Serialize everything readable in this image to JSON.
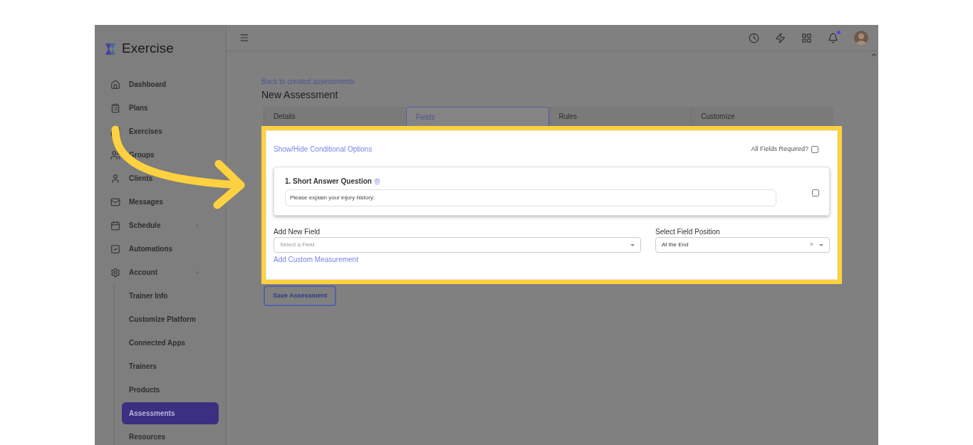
{
  "brand": "Exercise",
  "sidebar": {
    "items": [
      {
        "label": "Dashboard",
        "kind": "link",
        "selected": false
      },
      {
        "label": "Plans",
        "kind": "link",
        "selected": false
      },
      {
        "label": "Exercises",
        "kind": "link",
        "selected": false
      },
      {
        "label": "Groups",
        "kind": "link",
        "selected": false
      },
      {
        "label": "Clients",
        "kind": "link",
        "selected": false
      },
      {
        "label": "Messages",
        "kind": "link",
        "selected": false
      },
      {
        "label": "Schedule",
        "kind": "group",
        "expanded": false,
        "selected": false
      },
      {
        "label": "Automations",
        "kind": "link",
        "selected": false
      },
      {
        "label": "Account",
        "kind": "group",
        "expanded": true,
        "selected": false,
        "children": [
          {
            "label": "Trainer Info",
            "selected": false
          },
          {
            "label": "Customize Platform",
            "selected": false
          },
          {
            "label": "Connected Apps",
            "selected": false
          },
          {
            "label": "Trainers",
            "selected": false
          },
          {
            "label": "Products",
            "selected": false
          },
          {
            "label": "Assessments",
            "selected": true
          },
          {
            "label": "Resources",
            "selected": false
          }
        ]
      }
    ]
  },
  "topbar": {
    "notifications_unread": true
  },
  "page": {
    "back_link": "Back to created assessments",
    "title": "New Assessment",
    "tabs": [
      {
        "label": "Details",
        "selected": false
      },
      {
        "label": "Fields",
        "selected": true
      },
      {
        "label": "Rules",
        "selected": false
      },
      {
        "label": "Customize",
        "selected": false
      }
    ],
    "conditional_link": "Show/Hide Conditional Options",
    "all_required": {
      "label": "All Fields Required?",
      "checked": false
    },
    "questions": [
      {
        "title": "1. Short Answer Question",
        "value": "Please explain your injury history:",
        "checked": false
      }
    ],
    "add_field": {
      "label": "Add New Field",
      "placeholder": "Select a Field"
    },
    "position": {
      "label": "Select Field Position",
      "value": "At the End",
      "clear": "×"
    },
    "custom_link": "Add Custom Measurement",
    "save_button": "Save Assessment"
  }
}
